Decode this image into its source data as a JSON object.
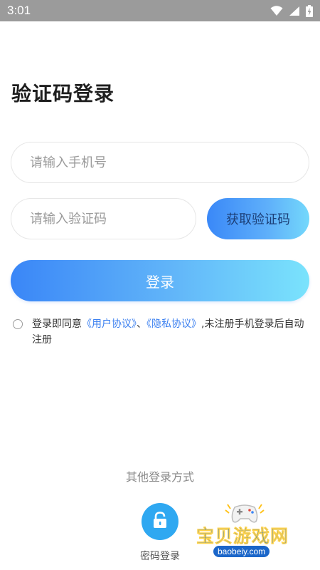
{
  "status_bar": {
    "time": "3:01",
    "icons": [
      "wifi-icon",
      "signal-icon",
      "battery-charging-icon"
    ]
  },
  "page": {
    "title": "验证码登录"
  },
  "form": {
    "phone_placeholder": "请输入手机号",
    "code_placeholder": "请输入验证码",
    "get_code_label": "获取验证码",
    "login_label": "登录"
  },
  "agreement": {
    "prefix": "登录即同意",
    "user_agreement": "《用户协议》",
    "separator": "、",
    "privacy_agreement": "《隐私协议》",
    "suffix": ",未注册手机登录后自动注册",
    "checked": false
  },
  "other_login": {
    "title": "其他登录方式",
    "password_login_label": "密码登录",
    "password_login_icon": "unlock-icon"
  },
  "watermark": {
    "text": "宝贝游戏网",
    "url": "baobeiy.com",
    "icon": "gamepad-icon"
  },
  "colors": {
    "status_bar": "#9b9b9b",
    "accent_blue": "#3a86f7",
    "accent_cyan": "#7ae3fc",
    "link": "#3a7ff0",
    "password_icon_bg": "#2fa8f1"
  }
}
